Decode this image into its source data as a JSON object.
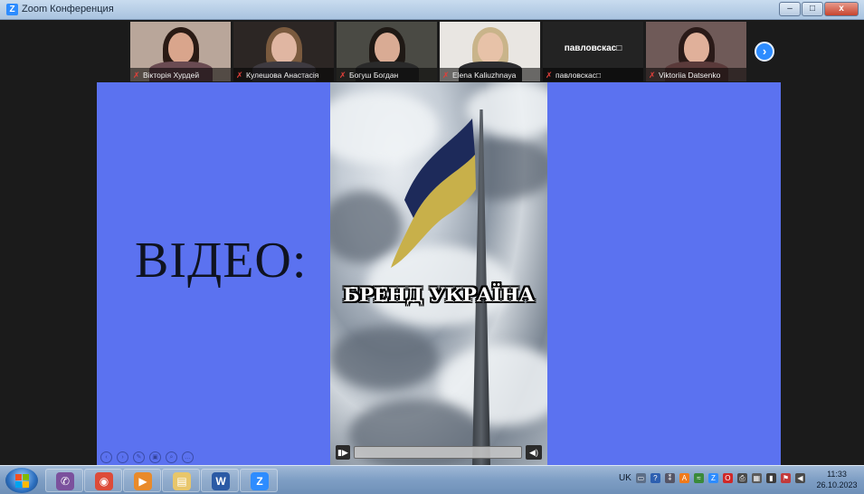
{
  "window": {
    "title": "Zoom Конференция",
    "buttons": {
      "minimize": "–",
      "maximize": "□",
      "close": "x"
    }
  },
  "participants": [
    {
      "name": "Вікторія Хурдей",
      "muted": true,
      "video": true,
      "skin": "#d9a58c",
      "hair": "#2a1a14",
      "body": "#6a4b52",
      "bg": "#b9a69a"
    },
    {
      "name": "Кулешова Анастасія",
      "muted": true,
      "video": true,
      "skin": "#e0b6a2",
      "hair": "#7a5a3e",
      "body": "#3e3a40",
      "bg": "#2c2624"
    },
    {
      "name": "Богуш Богдан",
      "muted": true,
      "video": true,
      "active": true,
      "skin": "#d9ab94",
      "hair": "#1f1915",
      "body": "#2a2a2a",
      "bg": "#4a4a44"
    },
    {
      "name": "Elena Kaliuzhnaya",
      "muted": true,
      "video": true,
      "skin": "#e7c2a8",
      "hair": "#c9b48a",
      "body": "#2d2d30",
      "bg": "#e9e6e2"
    },
    {
      "name": "павловскас□",
      "muted": true,
      "video": false,
      "display_name": "павловскас□"
    },
    {
      "name": "Viktoriia Datsenko",
      "muted": true,
      "video": true,
      "skin": "#e0b09a",
      "hair": "#2a1a18",
      "body": "#5a3a3a",
      "bg": "#6f5a58"
    }
  ],
  "next_button": "›",
  "slide": {
    "title": "ВІДЕО:",
    "background": "#5b72f0",
    "video": {
      "caption": "БРЕНД УКРАЇНА",
      "play_icon": "▮▶",
      "volume_icon": "◀)"
    },
    "tools": [
      "‹",
      "›",
      "✎",
      "▣",
      "⌕",
      "…"
    ]
  },
  "taskbar": {
    "apps": [
      {
        "name": "viber",
        "glyph": "✆",
        "color": "#7b519d"
      },
      {
        "name": "chrome",
        "glyph": "◉",
        "color": "#dd4b39"
      },
      {
        "name": "media-player",
        "glyph": "▶",
        "color": "#e98a2a"
      },
      {
        "name": "explorer",
        "glyph": "▤",
        "color": "#e8c66a"
      },
      {
        "name": "word",
        "glyph": "W",
        "color": "#2b5aa5"
      },
      {
        "name": "zoom",
        "glyph": "Z",
        "color": "#2d8cff"
      }
    ],
    "tray": {
      "lang": "UK",
      "icons": [
        {
          "name": "keyboard",
          "glyph": "▭",
          "color": "#5d6f88"
        },
        {
          "name": "help",
          "glyph": "?",
          "color": "#2d5fb0"
        },
        {
          "name": "pointer",
          "glyph": "⁑",
          "color": "#556"
        },
        {
          "name": "avast",
          "glyph": "A",
          "color": "#f07a1a"
        },
        {
          "name": "network-manager",
          "glyph": "≈",
          "color": "#3a8a3a"
        },
        {
          "name": "zoom-tray",
          "glyph": "Z",
          "color": "#2d8cff"
        },
        {
          "name": "opera",
          "glyph": "O",
          "color": "#d02828"
        },
        {
          "name": "printer",
          "glyph": "⎙",
          "color": "#4a4a4a"
        },
        {
          "name": "display",
          "glyph": "▦",
          "color": "#5b5b5b"
        },
        {
          "name": "signal",
          "glyph": "▮",
          "color": "#3c3c3c"
        },
        {
          "name": "flag",
          "glyph": "⚑",
          "color": "#c23a3a"
        },
        {
          "name": "volume",
          "glyph": "◀",
          "color": "#4b4b4b"
        }
      ]
    },
    "clock": {
      "time": "11:33",
      "date": "26.10.2023"
    }
  }
}
